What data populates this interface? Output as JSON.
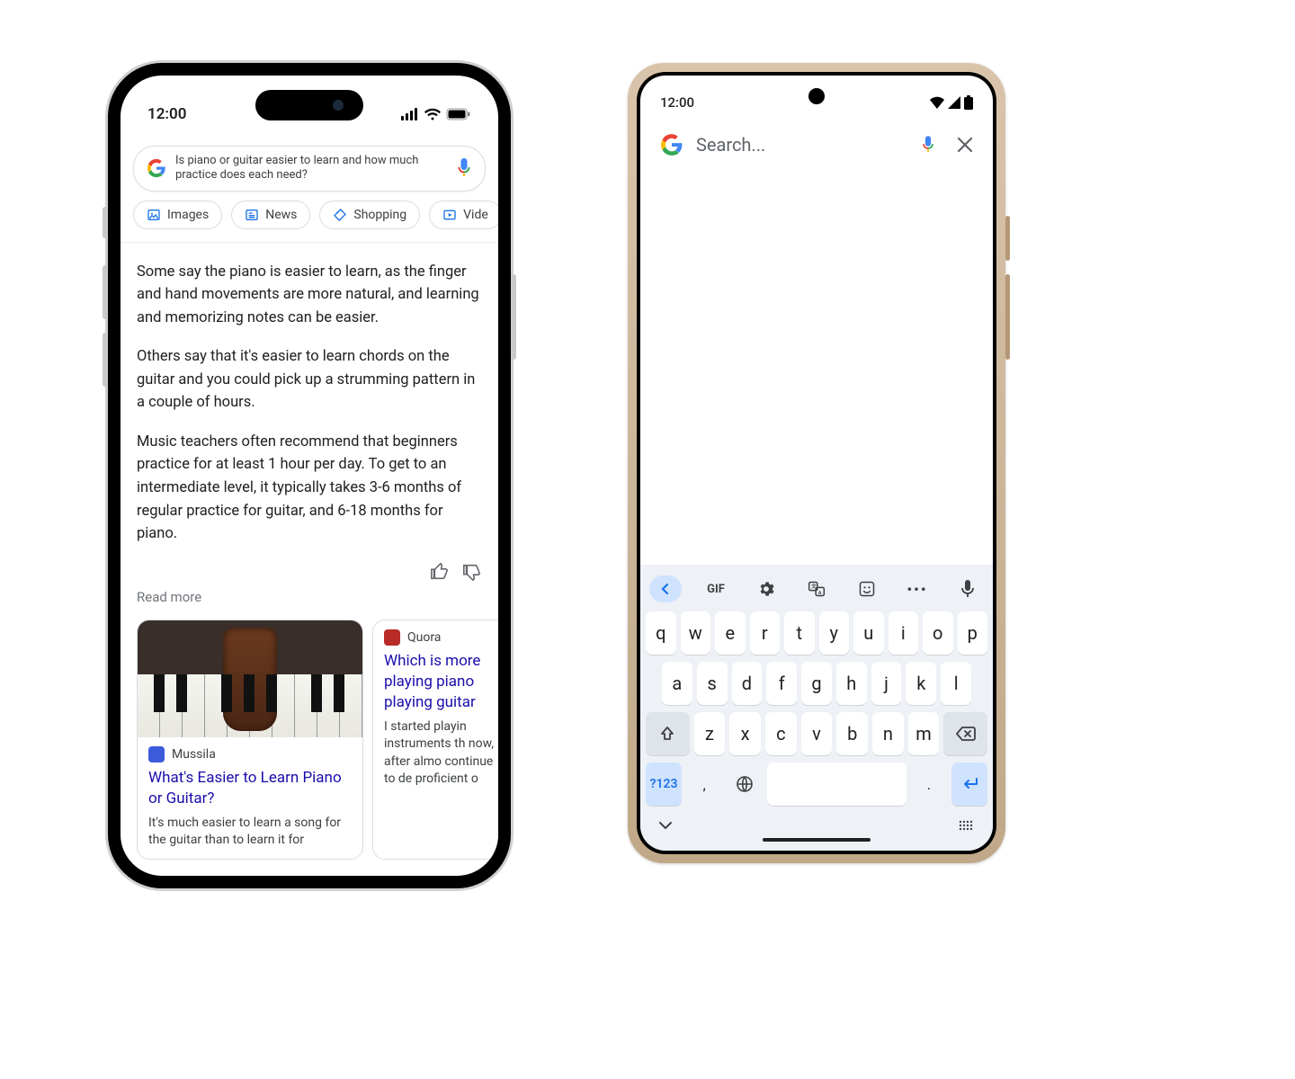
{
  "iphone": {
    "status": {
      "time": "12:00"
    },
    "search": {
      "query": "Is piano or guitar easier to learn and how much practice does each need?"
    },
    "chips": [
      {
        "name": "images",
        "label": "Images"
      },
      {
        "name": "news",
        "label": "News"
      },
      {
        "name": "shopping",
        "label": "Shopping"
      },
      {
        "name": "videos",
        "label": "Vide"
      }
    ],
    "answer": {
      "p1": "Some say the piano is easier to learn, as the finger and hand movements are more natural, and learning and memorizing notes can be easier.",
      "p2": "Others say that it's easier to learn chords on the guitar and you could pick up a strumming pattern in a couple of hours.",
      "p3": "Music teachers often recommend that beginners practice for at least 1 hour per day. To get to an intermediate level, it typically takes 3-6 months of regular practice for guitar, and 6-18 months for piano."
    },
    "read_more": "Read more",
    "cards": [
      {
        "source": "Mussila",
        "title": "What's Easier to Learn Piano or Guitar?",
        "snippet": "It's much easier to learn a song for the guitar than to learn it for"
      },
      {
        "source": "Quora",
        "title": "Which is more playing piano playing guitar",
        "snippet": "I started playin instruments th now, after almo continue to de proficient o"
      }
    ]
  },
  "android": {
    "status": {
      "time": "12:00"
    },
    "search": {
      "placeholder": "Search..."
    },
    "keyboard": {
      "top": {
        "gif": "GIF",
        "more": "•••"
      },
      "row1": [
        "q",
        "w",
        "e",
        "r",
        "t",
        "y",
        "u",
        "i",
        "o",
        "p"
      ],
      "row2": [
        "a",
        "s",
        "d",
        "f",
        "g",
        "h",
        "j",
        "k",
        "l"
      ],
      "row3": [
        "z",
        "x",
        "c",
        "v",
        "b",
        "n",
        "m"
      ],
      "row4": {
        "sym": "?123",
        "comma": ",",
        "period": "."
      }
    }
  }
}
